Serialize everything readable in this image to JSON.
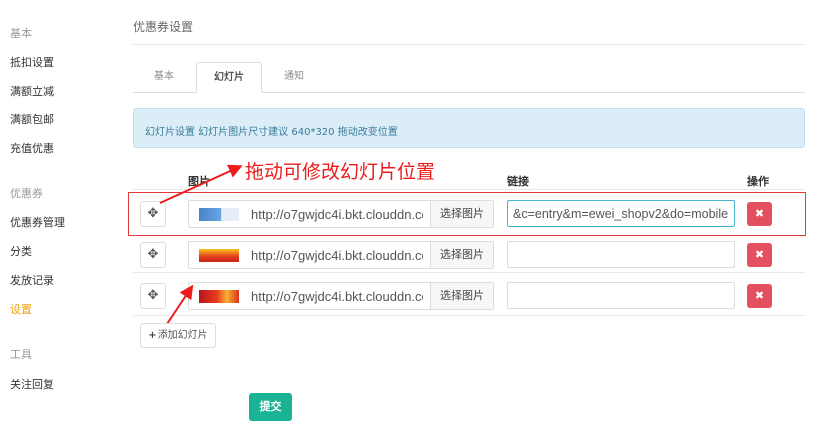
{
  "sidebar": {
    "groups": [
      {
        "label": "基本",
        "items": [
          "抵扣设置",
          "满额立减",
          "满额包邮",
          "充值优惠"
        ]
      },
      {
        "label": "优惠券",
        "items": [
          "优惠券管理",
          "分类",
          "发放记录",
          "设置"
        ]
      },
      {
        "label": "工具",
        "items": [
          "关注回复"
        ]
      }
    ],
    "active_item": "设置"
  },
  "page": {
    "title": "优惠券设置"
  },
  "tabs": [
    {
      "label": "基本",
      "active": false
    },
    {
      "label": "幻灯片",
      "active": true
    },
    {
      "label": "通知",
      "active": false
    }
  ],
  "info": {
    "text": "幻灯片设置 幻灯片图片尺寸建议 640*320 拖动改变位置"
  },
  "table": {
    "headers": {
      "image": "图片",
      "link": "链接",
      "action": "操作"
    },
    "rows": [
      {
        "image_url": "http://o7gwjdc4i.bkt.clouddn.co",
        "choose_label": "选择图片",
        "link": "&c=entry&m=ewei_shopv2&do=mobile",
        "highlighted": true
      },
      {
        "image_url": "http://o7gwjdc4i.bkt.clouddn.co",
        "choose_label": "选择图片",
        "link": "",
        "highlighted": false
      },
      {
        "image_url": "http://o7gwjdc4i.bkt.clouddn.co",
        "choose_label": "选择图片",
        "link": "",
        "highlighted": false
      }
    ],
    "delete_glyph": "✖",
    "drag_glyph": "✥"
  },
  "annotation": {
    "text": "拖动可修改幻灯片位置",
    "color": "#ee1b1b"
  },
  "buttons": {
    "add_slide": "添加幻灯片",
    "submit": "提交"
  },
  "icons": {
    "drag": "move-arrows-icon",
    "delete": "close-x-icon",
    "add": "plus-icon"
  },
  "colors": {
    "accent": "#1ab394",
    "active_sidebar": "#f0a30a",
    "danger": "#e4505f",
    "info_bg": "#dbeef7"
  }
}
